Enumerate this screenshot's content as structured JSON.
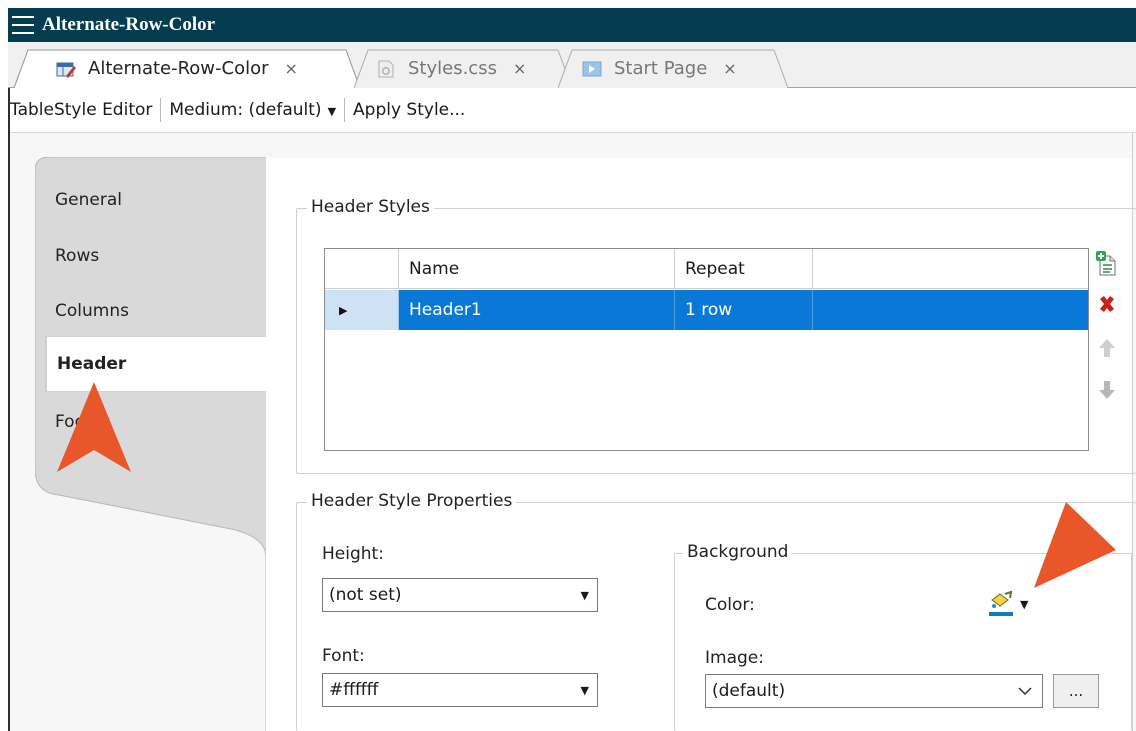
{
  "window": {
    "title": "Alternate-Row-Color"
  },
  "tabs": [
    {
      "label": "Alternate-Row-Color",
      "close": "×",
      "active": true
    },
    {
      "label": "Styles.css",
      "close": "×",
      "active": false
    },
    {
      "label": "Start Page",
      "close": "×",
      "active": false
    }
  ],
  "toolbar": {
    "editor_label": "TableStyle Editor",
    "medium_label": "Medium: (default)",
    "apply_label": "Apply Style..."
  },
  "sidebar": {
    "items": [
      {
        "label": "General",
        "active": false
      },
      {
        "label": "Rows",
        "active": false
      },
      {
        "label": "Columns",
        "active": false
      },
      {
        "label": "Header",
        "active": true
      },
      {
        "label": "Footer",
        "active": false
      }
    ]
  },
  "header_styles": {
    "legend": "Header Styles",
    "columns": [
      "",
      "Name",
      "Repeat",
      ""
    ],
    "rows": [
      {
        "indicator": "▶",
        "name": "Header1",
        "repeat": "1 row",
        "selected": true
      }
    ],
    "buttons": [
      "add-style-icon",
      "delete-x-icon",
      "move-up-arrow-icon",
      "move-down-arrow-icon"
    ]
  },
  "properties": {
    "legend": "Header Style Properties",
    "height_label": "Height:",
    "height_value": "(not set)",
    "font_label": "Font:",
    "font_value": "#ffffff",
    "background": {
      "legend": "Background",
      "color_label": "Color:",
      "image_label": "Image:",
      "image_value": "(default)",
      "browse_label": "..."
    }
  },
  "colors": {
    "title_bar": "#033d4f",
    "selection": "#0a78d7",
    "callout": "#e8562a"
  }
}
